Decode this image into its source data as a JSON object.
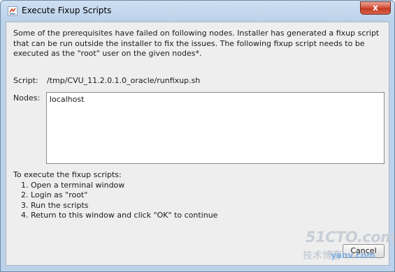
{
  "window": {
    "title": "Execute Fixup Scripts",
    "close_glyph": "x"
  },
  "message": {
    "lines": [
      "Some of the prerequisites have failed on following nodes. Installer has generated a fixup script",
      "that can be run outside the installer to fix the issues. The following fixup script needs to be",
      "executed as the \"root\" user on the given nodes*."
    ]
  },
  "script": {
    "label": "Script:",
    "path": "/tmp/CVU_11.2.0.1.0_oracle/runfixup.sh"
  },
  "nodes": {
    "label": "Nodes:",
    "value": "localhost"
  },
  "instructions": {
    "heading": "To execute the fixup scripts:",
    "steps": [
      "1. Open a terminal window",
      "2. Login as \"root\"",
      "3. Run the scripts",
      "4. Return to this window and click \"OK\" to continue"
    ]
  },
  "buttons": {
    "cancel_label": "Cancel"
  },
  "watermark": {
    "main": "51CTO.com",
    "chinese": "技术博客",
    "sub": "yanv.com"
  },
  "colors": {
    "title_bar": "#bcd2ea",
    "content_bg": "#eeeeee",
    "close_button": "#c23a22"
  },
  "icons": {
    "app": "java-coffee-icon",
    "close": "close-icon"
  }
}
